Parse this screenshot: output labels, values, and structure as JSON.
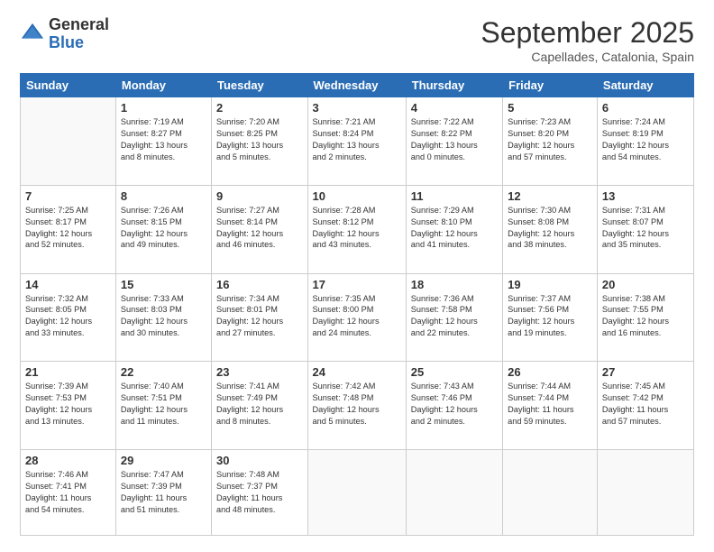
{
  "header": {
    "logo": {
      "general": "General",
      "blue": "Blue"
    },
    "title": "September 2025",
    "location": "Capellades, Catalonia, Spain"
  },
  "calendar": {
    "weekdays": [
      "Sunday",
      "Monday",
      "Tuesday",
      "Wednesday",
      "Thursday",
      "Friday",
      "Saturday"
    ],
    "weeks": [
      [
        {
          "day": "",
          "info": ""
        },
        {
          "day": "1",
          "info": "Sunrise: 7:19 AM\nSunset: 8:27 PM\nDaylight: 13 hours\nand 8 minutes."
        },
        {
          "day": "2",
          "info": "Sunrise: 7:20 AM\nSunset: 8:25 PM\nDaylight: 13 hours\nand 5 minutes."
        },
        {
          "day": "3",
          "info": "Sunrise: 7:21 AM\nSunset: 8:24 PM\nDaylight: 13 hours\nand 2 minutes."
        },
        {
          "day": "4",
          "info": "Sunrise: 7:22 AM\nSunset: 8:22 PM\nDaylight: 13 hours\nand 0 minutes."
        },
        {
          "day": "5",
          "info": "Sunrise: 7:23 AM\nSunset: 8:20 PM\nDaylight: 12 hours\nand 57 minutes."
        },
        {
          "day": "6",
          "info": "Sunrise: 7:24 AM\nSunset: 8:19 PM\nDaylight: 12 hours\nand 54 minutes."
        }
      ],
      [
        {
          "day": "7",
          "info": "Sunrise: 7:25 AM\nSunset: 8:17 PM\nDaylight: 12 hours\nand 52 minutes."
        },
        {
          "day": "8",
          "info": "Sunrise: 7:26 AM\nSunset: 8:15 PM\nDaylight: 12 hours\nand 49 minutes."
        },
        {
          "day": "9",
          "info": "Sunrise: 7:27 AM\nSunset: 8:14 PM\nDaylight: 12 hours\nand 46 minutes."
        },
        {
          "day": "10",
          "info": "Sunrise: 7:28 AM\nSunset: 8:12 PM\nDaylight: 12 hours\nand 43 minutes."
        },
        {
          "day": "11",
          "info": "Sunrise: 7:29 AM\nSunset: 8:10 PM\nDaylight: 12 hours\nand 41 minutes."
        },
        {
          "day": "12",
          "info": "Sunrise: 7:30 AM\nSunset: 8:08 PM\nDaylight: 12 hours\nand 38 minutes."
        },
        {
          "day": "13",
          "info": "Sunrise: 7:31 AM\nSunset: 8:07 PM\nDaylight: 12 hours\nand 35 minutes."
        }
      ],
      [
        {
          "day": "14",
          "info": "Sunrise: 7:32 AM\nSunset: 8:05 PM\nDaylight: 12 hours\nand 33 minutes."
        },
        {
          "day": "15",
          "info": "Sunrise: 7:33 AM\nSunset: 8:03 PM\nDaylight: 12 hours\nand 30 minutes."
        },
        {
          "day": "16",
          "info": "Sunrise: 7:34 AM\nSunset: 8:01 PM\nDaylight: 12 hours\nand 27 minutes."
        },
        {
          "day": "17",
          "info": "Sunrise: 7:35 AM\nSunset: 8:00 PM\nDaylight: 12 hours\nand 24 minutes."
        },
        {
          "day": "18",
          "info": "Sunrise: 7:36 AM\nSunset: 7:58 PM\nDaylight: 12 hours\nand 22 minutes."
        },
        {
          "day": "19",
          "info": "Sunrise: 7:37 AM\nSunset: 7:56 PM\nDaylight: 12 hours\nand 19 minutes."
        },
        {
          "day": "20",
          "info": "Sunrise: 7:38 AM\nSunset: 7:55 PM\nDaylight: 12 hours\nand 16 minutes."
        }
      ],
      [
        {
          "day": "21",
          "info": "Sunrise: 7:39 AM\nSunset: 7:53 PM\nDaylight: 12 hours\nand 13 minutes."
        },
        {
          "day": "22",
          "info": "Sunrise: 7:40 AM\nSunset: 7:51 PM\nDaylight: 12 hours\nand 11 minutes."
        },
        {
          "day": "23",
          "info": "Sunrise: 7:41 AM\nSunset: 7:49 PM\nDaylight: 12 hours\nand 8 minutes."
        },
        {
          "day": "24",
          "info": "Sunrise: 7:42 AM\nSunset: 7:48 PM\nDaylight: 12 hours\nand 5 minutes."
        },
        {
          "day": "25",
          "info": "Sunrise: 7:43 AM\nSunset: 7:46 PM\nDaylight: 12 hours\nand 2 minutes."
        },
        {
          "day": "26",
          "info": "Sunrise: 7:44 AM\nSunset: 7:44 PM\nDaylight: 11 hours\nand 59 minutes."
        },
        {
          "day": "27",
          "info": "Sunrise: 7:45 AM\nSunset: 7:42 PM\nDaylight: 11 hours\nand 57 minutes."
        }
      ],
      [
        {
          "day": "28",
          "info": "Sunrise: 7:46 AM\nSunset: 7:41 PM\nDaylight: 11 hours\nand 54 minutes."
        },
        {
          "day": "29",
          "info": "Sunrise: 7:47 AM\nSunset: 7:39 PM\nDaylight: 11 hours\nand 51 minutes."
        },
        {
          "day": "30",
          "info": "Sunrise: 7:48 AM\nSunset: 7:37 PM\nDaylight: 11 hours\nand 48 minutes."
        },
        {
          "day": "",
          "info": ""
        },
        {
          "day": "",
          "info": ""
        },
        {
          "day": "",
          "info": ""
        },
        {
          "day": "",
          "info": ""
        }
      ]
    ]
  }
}
